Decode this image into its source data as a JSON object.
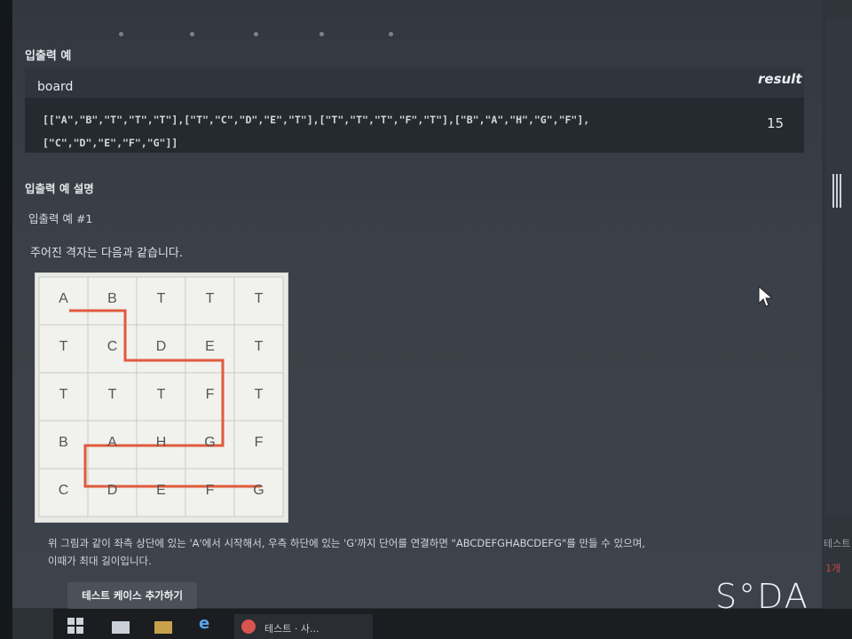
{
  "io_example": {
    "section_title": "입출력 예",
    "col_board": "board",
    "col_result": "result",
    "board_value": "[[\"A\",\"B\",\"T\",\"T\",\"T\"],[\"T\",\"C\",\"D\",\"E\",\"T\"],[\"T\",\"T\",\"T\",\"F\",\"T\"],[\"B\",\"A\",\"H\",\"G\",\"F\"],[\"C\",\"D\",\"E\",\"F\",\"G\"]]",
    "result_value": "15"
  },
  "explanation": {
    "title": "입출력 예 설명",
    "subtitle": "입출력 예 #1",
    "grid_desc": "주어진 격자는 다음과 같습니다.",
    "grid": [
      [
        "A",
        "B",
        "T",
        "T",
        "T"
      ],
      [
        "T",
        "C",
        "D",
        "E",
        "T"
      ],
      [
        "T",
        "T",
        "T",
        "F",
        "T"
      ],
      [
        "B",
        "A",
        "H",
        "G",
        "F"
      ],
      [
        "C",
        "D",
        "E",
        "F",
        "G"
      ]
    ],
    "path_color": "#e05a3c",
    "caption_line1": "위 그림과 같이 좌측 상단에 있는 'A'에서 시작해서, 우측 하단에 있는 'G'까지 단어를 연결하면 \"ABCDEFGHABCDEFG\"를 만들 수 있으며,",
    "caption_line2": "이때가 최대 길이입니다."
  },
  "buttons": {
    "add_test_case": "테스트 케이스 추가하기"
  },
  "right_panel": {
    "label": "테스트",
    "status": "1개"
  },
  "taskbar": {
    "active_task": "테스트 · 사..."
  },
  "watermark": "S°DA"
}
